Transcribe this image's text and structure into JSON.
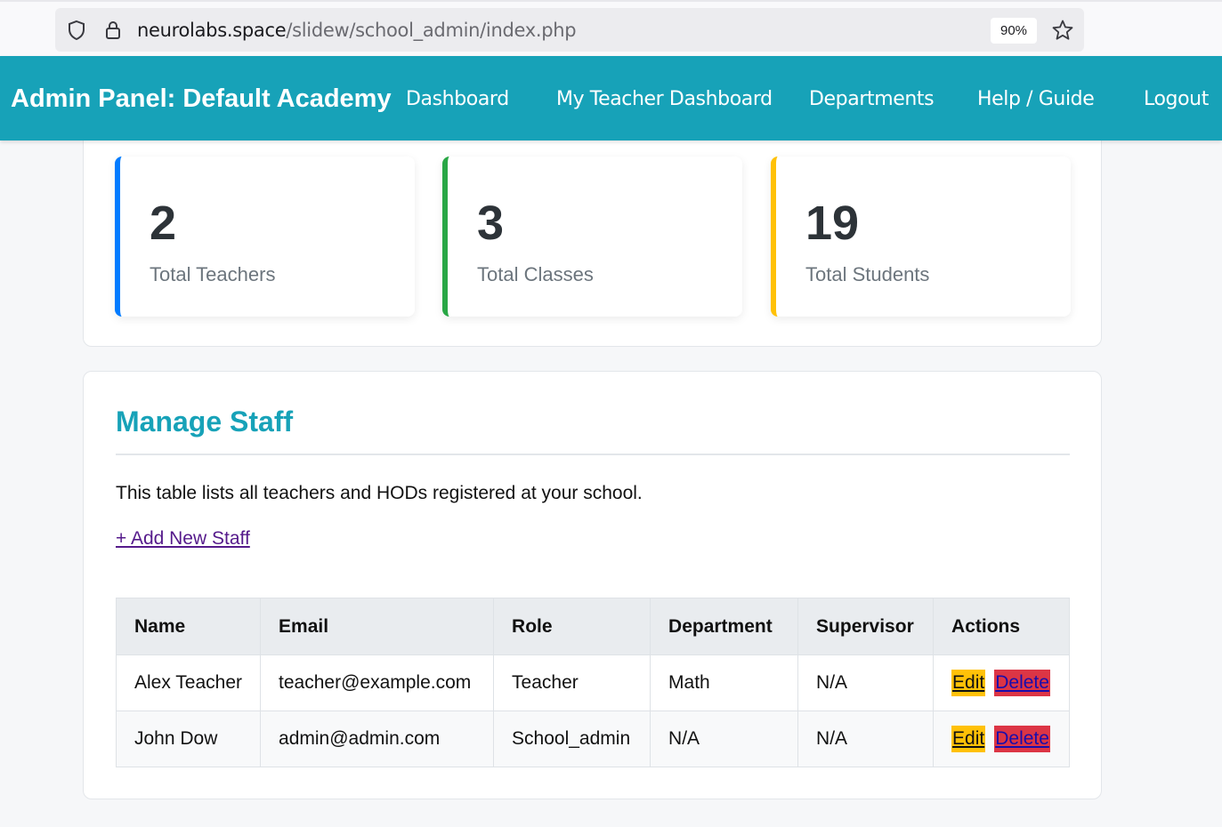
{
  "browser": {
    "url_host": "neurolabs.space",
    "url_path": "/slidew/school_admin/index.php",
    "zoom": "90%"
  },
  "navbar": {
    "brand": "Admin Panel: Default Academy",
    "links": [
      "Dashboard",
      "My Teacher Dashboard",
      "Departments",
      "Help / Guide",
      "Logout"
    ]
  },
  "stats": [
    {
      "value": "2",
      "label": "Total Teachers",
      "color": "#007bff"
    },
    {
      "value": "3",
      "label": "Total Classes",
      "color": "#28a745"
    },
    {
      "value": "19",
      "label": "Total Students",
      "color": "#ffc107"
    }
  ],
  "staff": {
    "title": "Manage Staff",
    "description": "This table lists all teachers and HODs registered at your school.",
    "add_link": "+ Add New Staff",
    "columns": [
      "Name",
      "Email",
      "Role",
      "Department",
      "Supervisor",
      "Actions"
    ],
    "rows": [
      {
        "name": "Alex Teacher",
        "email": "teacher@example.com",
        "role": "Teacher",
        "department": "Math",
        "supervisor": "N/A",
        "edit": "Edit",
        "delete": "Delete"
      },
      {
        "name": "John Dow",
        "email": "admin@admin.com",
        "role": "School_admin",
        "department": "N/A",
        "supervisor": "N/A",
        "edit": "Edit",
        "delete": "Delete"
      }
    ]
  },
  "colors": {
    "accent": "#17a2b8",
    "edit_button": "#ffc107",
    "delete_button": "#dc3545"
  }
}
